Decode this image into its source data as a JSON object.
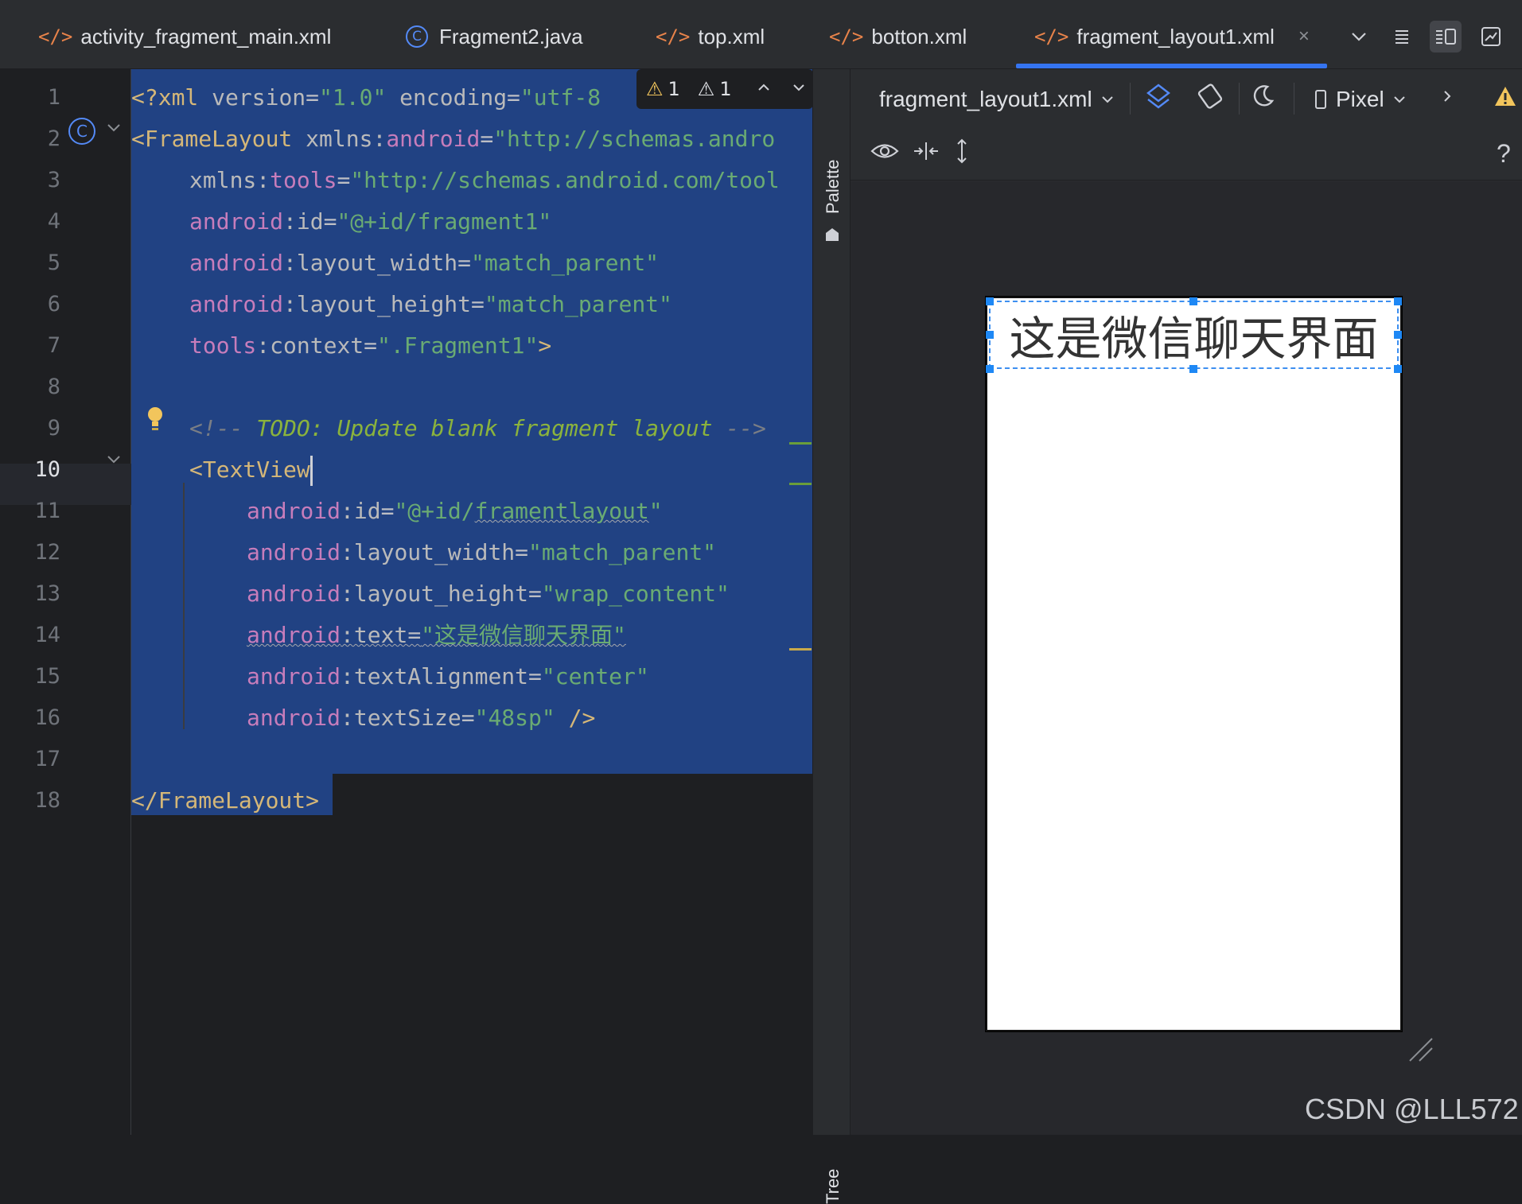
{
  "tabs": [
    {
      "label": "activity_fragment_main.xml",
      "icon": "xml-code-icon"
    },
    {
      "label": "Fragment2.java",
      "icon": "class-c-icon"
    },
    {
      "label": "top.xml",
      "icon": "xml-code-icon"
    },
    {
      "label": "botton.xml",
      "icon": "xml-code-icon"
    },
    {
      "label": "fragment_layout1.xml",
      "icon": "xml-code-icon",
      "active": true,
      "close": "×"
    }
  ],
  "toolbar_icons": {
    "more_tabs": "⌄",
    "code_view": "≡",
    "split_view": "◫",
    "design_view": "▣"
  },
  "inspection": {
    "warning_count_1": "1",
    "warning_count_2": "1"
  },
  "line_numbers": [
    "1",
    "2",
    "3",
    "4",
    "5",
    "6",
    "7",
    "8",
    "9",
    "10",
    "11",
    "12",
    "13",
    "14",
    "15",
    "16",
    "17",
    "18"
  ],
  "code": {
    "l1": {
      "a": "<?xml ",
      "b": "version",
      "c": "=",
      "d": "\"1.0\"",
      "e": " encoding",
      "f": "=",
      "g": "\"utf-8"
    },
    "l2": {
      "a": "<FrameLayout ",
      "b": "xmlns:",
      "c": "android",
      "d": "=",
      "e": "\"http://schemas.andro"
    },
    "l3": {
      "a": "xmlns:",
      "b": "tools",
      "c": "=",
      "d": "\"http://schemas.android.com/tool"
    },
    "l4": {
      "a": "android",
      "b": ":id",
      "c": "=",
      "d": "\"@+id/fragment1\""
    },
    "l5": {
      "a": "android",
      "b": ":layout_width",
      "c": "=",
      "d": "\"match_parent\""
    },
    "l6": {
      "a": "android",
      "b": ":layout_height",
      "c": "=",
      "d": "\"match_parent\""
    },
    "l7": {
      "a": "tools",
      "b": ":context",
      "c": "=",
      "d": "\".Fragment1\"",
      "e": ">"
    },
    "l9": {
      "a": "<!-- ",
      "b": "TODO: Update blank fragment layout",
      "c": " -->"
    },
    "l10": {
      "a": "<TextView"
    },
    "l11": {
      "a": "android",
      "b": ":id",
      "c": "=",
      "d": "\"@+id/",
      "e": "framentlayout",
      "f": "\""
    },
    "l12": {
      "a": "android",
      "b": ":layout_width",
      "c": "=",
      "d": "\"match_parent\""
    },
    "l13": {
      "a": "android",
      "b": ":layout_height",
      "c": "=",
      "d": "\"wrap_content\""
    },
    "l14": {
      "a": "android",
      "b": ":text",
      "c": "=",
      "d": "\"这是微信聊天界面\""
    },
    "l15": {
      "a": "android",
      "b": ":textAlignment",
      "c": "=",
      "d": "\"center\""
    },
    "l16": {
      "a": "android",
      "b": ":textSize",
      "c": "=",
      "d": "\"48sp\"",
      "e": " />"
    },
    "l18": {
      "a": "</FrameLayout>"
    }
  },
  "side_panels": {
    "palette": "Palette",
    "tree": "Tree"
  },
  "design_toolbar": {
    "file_select": "fragment_layout1.xml",
    "device": "Pixel",
    "help": "?"
  },
  "preview": {
    "text": "这是微信聊天界面"
  },
  "watermark": "CSDN @LLL572",
  "colors": {
    "accent": "#3574f0",
    "selection": "#214283",
    "warning": "#f2c55c"
  }
}
